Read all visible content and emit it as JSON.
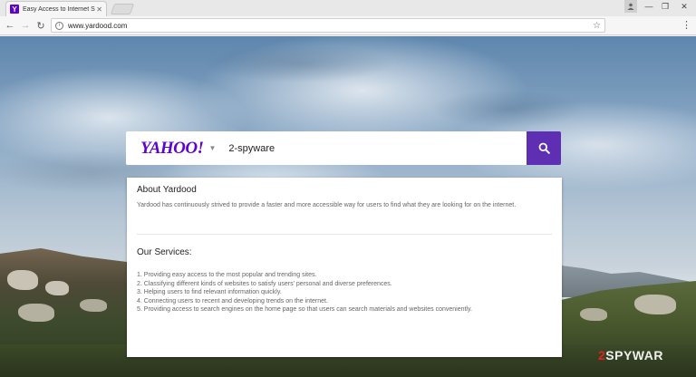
{
  "browser": {
    "tab_title": "Easy Access to Internet S",
    "tab_favicon_letter": "Y",
    "url": "www.yardood.com"
  },
  "search": {
    "logo": "YAHOO!",
    "query": "2-spyware",
    "accent_color": "#5f01d1"
  },
  "about": {
    "title": "About Yardood",
    "text": "Yardood has continuously strived to provide a faster and more accessible way for users to find what they are looking for on the internet."
  },
  "services": {
    "title": "Our Services:",
    "items": [
      "1. Providing easy access to the most popular and trending sites.",
      "2. Classifying different kinds of websites to satisfy users' personal and diverse preferences.",
      "3. Helping users to find relevant information quickly.",
      "4. Connecting users to recent and developing trends on the internet.",
      "5. Providing access to search engines on the home page so that users can search materials and websites conveniently."
    ]
  },
  "watermark": {
    "num": "2",
    "text": "SPYWAR"
  }
}
